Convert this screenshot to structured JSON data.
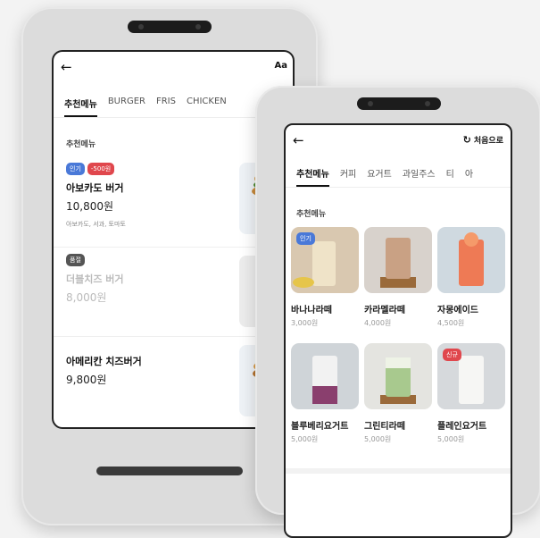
{
  "back_screen": {
    "text_size_label": "Aa",
    "tabs": [
      {
        "label": "추천메뉴",
        "active": true
      },
      {
        "label": "BURGER"
      },
      {
        "label": "FRIS"
      },
      {
        "label": "CHICKEN"
      }
    ],
    "section_title": "추천메뉴",
    "items": [
      {
        "badges": [
          "인기",
          "-500원"
        ],
        "name": "아보카도 버거",
        "price": "10,800원",
        "desc": "아보카도, 서과, 토마토"
      },
      {
        "badges": [
          "품절"
        ],
        "name": "더블치즈 버거",
        "price": "8,000원",
        "sold_out": true
      },
      {
        "name": "아메리칸 치즈버거",
        "price": "9,800원"
      }
    ]
  },
  "front_screen": {
    "restart_label": "처음으로",
    "tabs": [
      {
        "label": "추천메뉴",
        "active": true
      },
      {
        "label": "커피"
      },
      {
        "label": "요거트"
      },
      {
        "label": "과일주스"
      },
      {
        "label": "티"
      },
      {
        "label": "아"
      }
    ],
    "section_title": "추천메뉴",
    "items": [
      {
        "name": "바나나라떼",
        "price": "3,000원",
        "badge": "인기"
      },
      {
        "name": "카라멜라떼",
        "price": "4,000원"
      },
      {
        "name": "자몽에이드",
        "price": "4,500원"
      },
      {
        "name": "블루베리요거트",
        "price": "5,000원"
      },
      {
        "name": "그린티라떼",
        "price": "5,000원"
      },
      {
        "name": "플레인요거트",
        "price": "5,000원",
        "badge": "신규"
      }
    ]
  },
  "colors": {
    "accent_blue": "#4a79d8",
    "accent_red": "#e0474d"
  },
  "icons": {
    "back": "arrow-left-icon",
    "restart": "refresh-icon"
  }
}
